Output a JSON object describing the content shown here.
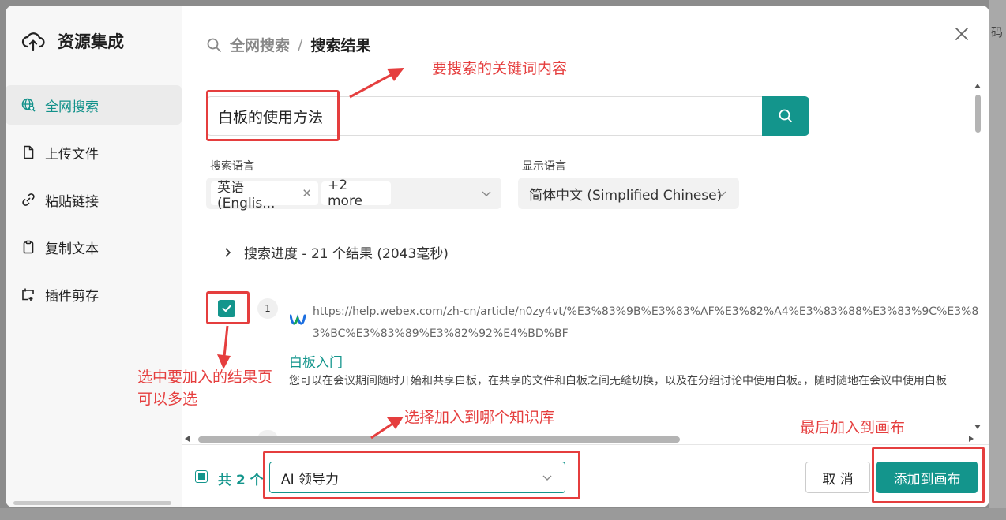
{
  "background": {
    "edge_char": "码"
  },
  "sidebar": {
    "title": "资源集成",
    "items": [
      {
        "label": "全网搜索",
        "icon": "globe-search-icon",
        "active": true
      },
      {
        "label": "上传文件",
        "icon": "file-icon",
        "active": false
      },
      {
        "label": "粘贴链接",
        "icon": "link-icon",
        "active": false
      },
      {
        "label": "复制文本",
        "icon": "clipboard-icon",
        "active": false
      },
      {
        "label": "插件剪存",
        "icon": "clip-save-icon",
        "active": false
      }
    ]
  },
  "header": {
    "crumb_1": "全网搜索",
    "separator": "/",
    "crumb_2": "搜索结果"
  },
  "search": {
    "value": "白板的使用方法"
  },
  "filters": {
    "search_lang_label": "搜索语言",
    "search_lang_tag": "英语 (Englis...",
    "search_lang_more": "+2 more",
    "display_lang_label": "显示语言",
    "display_lang_value": "简体中文 (Simplified Chinese)"
  },
  "progress": {
    "text": "搜索进度 - 21 个结果 (2043毫秒)"
  },
  "results": [
    {
      "index": "1",
      "checked": true,
      "url": "https://help.webex.com/zh-cn/article/n0zy4vt/%E3%83%9B%E3%83%AF%E3%82%A4%E3%83%88%E3%83%9C%E3%83%BC%E3%83%89%E3%82%92%E4%BD%BF",
      "title": "白板入门",
      "snippet": "您可以在会议期间随时开始和共享白板，在共享的文件和白板之间无缝切换，以及在分组讨论中使用白板。，随时随地在会议中使用白板"
    }
  ],
  "footer": {
    "count_label": "共 2 个",
    "knowledge_base": "AI 领导力",
    "cancel_label": "取 消",
    "add_label": "添加到画布"
  },
  "annotations": {
    "keyword": "要搜索的关键词内容",
    "select_line1": "选中要加入的结果页",
    "select_line2": "可以多选",
    "kb": "选择加入到哪个知识库",
    "canvas": "最后加入到画布"
  },
  "colors": {
    "accent": "#13958c",
    "annotation": "#e53e3e"
  }
}
